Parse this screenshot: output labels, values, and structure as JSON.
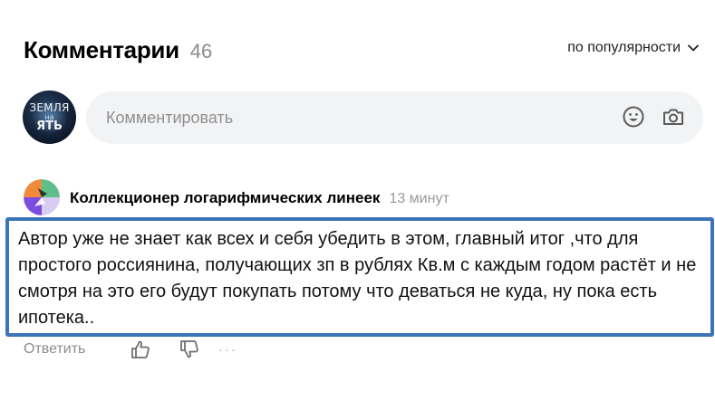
{
  "header": {
    "title": "Комментарии",
    "count": "46",
    "sort_label": "по популярности"
  },
  "composer": {
    "avatar_text_top": "ЗЕМЛЯ",
    "avatar_text_mid": "на",
    "avatar_text_bottom": "ЯТЬ",
    "placeholder": "Комментировать",
    "icons": [
      "emoji-icon",
      "camera-icon"
    ]
  },
  "comment": {
    "author": "Коллекционер логарифмических линеек",
    "time": "13 минут",
    "text": "Автор уже не знает как всех и себя убедить в этом, главный итог ,что для простого россиянина, получающих зп в рублях Кв.м с каждым годом растёт и не смотря на это его будут покупать потому что деваться не куда, ну пока есть ипотека..",
    "reply_label": "Ответить",
    "highlight_color": "#3b74b8"
  }
}
